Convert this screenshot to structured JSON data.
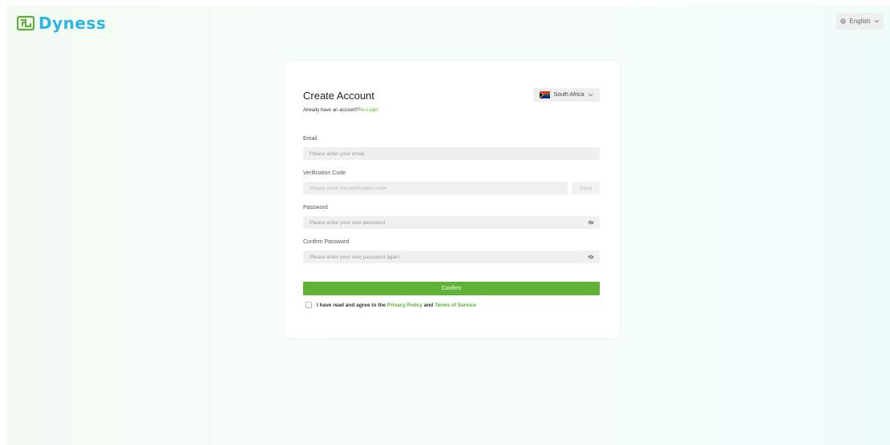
{
  "brand": {
    "name": "Dyness",
    "color": "#29b6e6",
    "mark_color": "#5daf34"
  },
  "header": {
    "language": {
      "label": "English",
      "icon": "globe-icon"
    }
  },
  "form": {
    "title": "Create Account",
    "region": {
      "label": "South Africa",
      "flag": "south-africa-flag-icon"
    },
    "login_hint": {
      "text": "Already have an account?",
      "link": "Re-Login"
    },
    "email": {
      "label": "Email",
      "placeholder": "Please enter your email"
    },
    "verification": {
      "label": "Verification Code",
      "placeholder": "Please enter the verification code",
      "send_label": "Send"
    },
    "password": {
      "label": "Password",
      "placeholder": "Please enter your new password"
    },
    "confirm_password": {
      "label": "Confirm Password",
      "placeholder": "Please enter your new password again"
    },
    "confirm_label": "Confirm",
    "agreement": {
      "prefix": "I have read and agree to the",
      "privacy": "Privacy Policy",
      "and": "and",
      "terms": "Terms of Service",
      "checked": false
    }
  },
  "colors": {
    "accent": "#5fb236",
    "link": "#5daf34",
    "input_bg": "#eff1f0"
  }
}
